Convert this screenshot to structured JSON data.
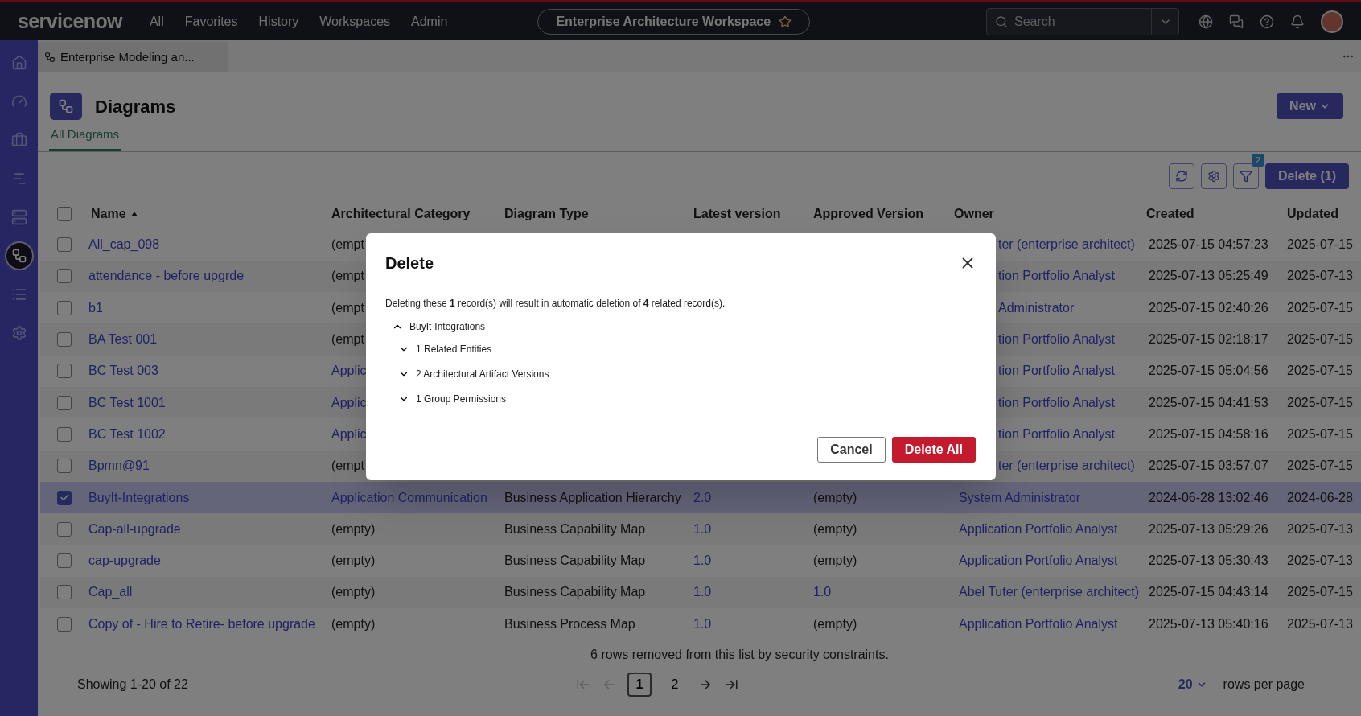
{
  "top_nav": {
    "logo": "servicenow",
    "menu": [
      "All",
      "Favorites",
      "History",
      "Workspaces",
      "Admin"
    ],
    "workspace_title": "Enterprise Architecture Workspace",
    "search": {
      "placeholder": "Search"
    }
  },
  "sidebar": {
    "items": [
      {
        "kind": "home",
        "selected": false
      },
      {
        "kind": "gauge",
        "selected": false
      },
      {
        "kind": "briefcase",
        "selected": false
      },
      {
        "kind": "bars",
        "selected": false
      },
      {
        "kind": "server",
        "selected": false
      },
      {
        "kind": "diagram",
        "selected": true
      },
      {
        "kind": "list",
        "selected": false
      },
      {
        "kind": "settings",
        "selected": false
      }
    ]
  },
  "tab_strip": {
    "tab": "Enterprise Modeling an..."
  },
  "page": {
    "title": "Diagrams",
    "new_button": "New",
    "tabs": [
      {
        "label": "All Diagrams",
        "selected": true
      }
    ]
  },
  "toolbar": {
    "filter_count": "2",
    "delete_button": "Delete (1)"
  },
  "table": {
    "header_checked": false,
    "columns": [
      {
        "label": "Name",
        "sorted": true
      },
      {
        "label": "Architectural Category",
        "sorted": false
      },
      {
        "label": "Diagram Type",
        "sorted": false
      },
      {
        "label": "Latest version",
        "sorted": false
      },
      {
        "label": "Approved Version",
        "sorted": false
      },
      {
        "label": "Owner",
        "sorted": false
      },
      {
        "label": "Created",
        "sorted": false
      },
      {
        "label": "Updated",
        "sorted": false
      }
    ],
    "rows": [
      {
        "selected": false,
        "name": "All_cap_098",
        "category": {
          "text": "(empt",
          "link": false
        },
        "owner": "ter (enterprise architect)",
        "created": "2025-07-15 04:57:23",
        "updated": "2025-07-15"
      },
      {
        "selected": false,
        "name": "attendance - before upgrde",
        "category": {
          "text": "(empt",
          "link": false
        },
        "owner": "tion Portfolio Analyst",
        "created": "2025-07-13 05:25:49",
        "updated": "2025-07-13"
      },
      {
        "selected": false,
        "name": "b1",
        "category": {
          "text": "(empt",
          "link": false
        },
        "owner": "Administrator",
        "created": "2025-07-15 02:40:26",
        "updated": "2025-07-15"
      },
      {
        "selected": false,
        "name": "BA Test 001",
        "category": {
          "text": "(empt",
          "link": false
        },
        "owner": "tion Portfolio Analyst",
        "created": "2025-07-15 02:18:17",
        "updated": "2025-07-15"
      },
      {
        "selected": false,
        "name": "BC Test 003",
        "category": {
          "text": "Applic",
          "link": true
        },
        "owner": "tion Portfolio Analyst",
        "created": "2025-07-15 05:04:56",
        "updated": "2025-07-15"
      },
      {
        "selected": false,
        "name": "BC Test 1001",
        "category": {
          "text": "Applic",
          "link": true
        },
        "owner": "tion Portfolio Analyst",
        "created": "2025-07-15 04:41:53",
        "updated": "2025-07-15"
      },
      {
        "selected": false,
        "name": "BC Test 1002",
        "category": {
          "text": "Applic",
          "link": true
        },
        "owner": "tion Portfolio Analyst",
        "created": "2025-07-15 04:58:16",
        "updated": "2025-07-15"
      },
      {
        "selected": false,
        "name": "Bpmn@91",
        "category": {
          "text": "(empt",
          "link": false
        },
        "owner": "ter (enterprise architect)",
        "created": "2025-07-15 03:57:07",
        "updated": "2025-07-15"
      },
      {
        "selected": true,
        "name": "BuyIt-Integrations",
        "category": {
          "text": "Application Communication",
          "link": true
        },
        "diagram_type": "Business Application Hierarchy",
        "latest": "2.0",
        "approved": {
          "text": "(empty)",
          "link": false
        },
        "owner": "System Administrator",
        "created": "2024-06-28 13:02:46",
        "updated": "2024-06-28"
      },
      {
        "selected": false,
        "name": "Cap-all-upgrade",
        "category": {
          "text": "(empty)",
          "link": false
        },
        "diagram_type": "Business Capability Map",
        "latest": "1.0",
        "approved": {
          "text": "(empty)",
          "link": false
        },
        "owner": "Application Portfolio Analyst",
        "created": "2025-07-13 05:29:26",
        "updated": "2025-07-13"
      },
      {
        "selected": false,
        "name": "cap-upgrade",
        "category": {
          "text": "(empty)",
          "link": false
        },
        "diagram_type": "Business Capability Map",
        "latest": "1.0",
        "approved": {
          "text": "(empty)",
          "link": false
        },
        "owner": "Application Portfolio Analyst",
        "created": "2025-07-13 05:30:43",
        "updated": "2025-07-13"
      },
      {
        "selected": false,
        "name": "Cap_all",
        "category": {
          "text": "(empty)",
          "link": false
        },
        "diagram_type": "Business Capability Map",
        "latest": "1.0",
        "approved": {
          "text": "1.0",
          "link": true
        },
        "owner": "Abel Tuter (enterprise architect)",
        "created": "2025-07-15 04:43:14",
        "updated": "2025-07-15"
      },
      {
        "selected": false,
        "name": "Copy of - Hire to Retire-  before upgrade",
        "category": {
          "text": "(empty)",
          "link": false
        },
        "diagram_type": "Business Process Map",
        "latest": "1.0",
        "approved": {
          "text": "(empty)",
          "link": false
        },
        "owner": "Application Portfolio Analyst",
        "created": "2025-07-13 05:40:16",
        "updated": "2025-07-13"
      }
    ]
  },
  "footer": {
    "notice": "6 rows removed from this list by security constraints.",
    "showing": "Showing 1-20 of 22",
    "nav": [
      {
        "kind": "first",
        "disabled": true
      },
      {
        "kind": "prev",
        "disabled": true
      },
      {
        "kind": "next",
        "disabled": false
      },
      {
        "kind": "last",
        "disabled": false
      }
    ],
    "pages": [
      {
        "label": "1",
        "selected": true
      },
      {
        "label": "2",
        "selected": false
      }
    ],
    "rows_per_page": "20",
    "rows_per_page_label": "rows per page"
  },
  "dialog": {
    "title": "Delete",
    "message": "Deleting these **1** record(s) will result in automatic deletion of **4** related record(s).",
    "tree": {
      "label": "BuyIt-Integrations",
      "expanded": true,
      "children": [
        {
          "label": "1 Related Entities",
          "expanded": false
        },
        {
          "label": "2 Architectural Artifact Versions",
          "expanded": false
        },
        {
          "label": "1 Group Permissions",
          "expanded": false
        }
      ]
    },
    "buttons": [
      {
        "label": "Cancel",
        "kind": "secondary"
      },
      {
        "label": "Delete All",
        "kind": "primary"
      }
    ]
  }
}
